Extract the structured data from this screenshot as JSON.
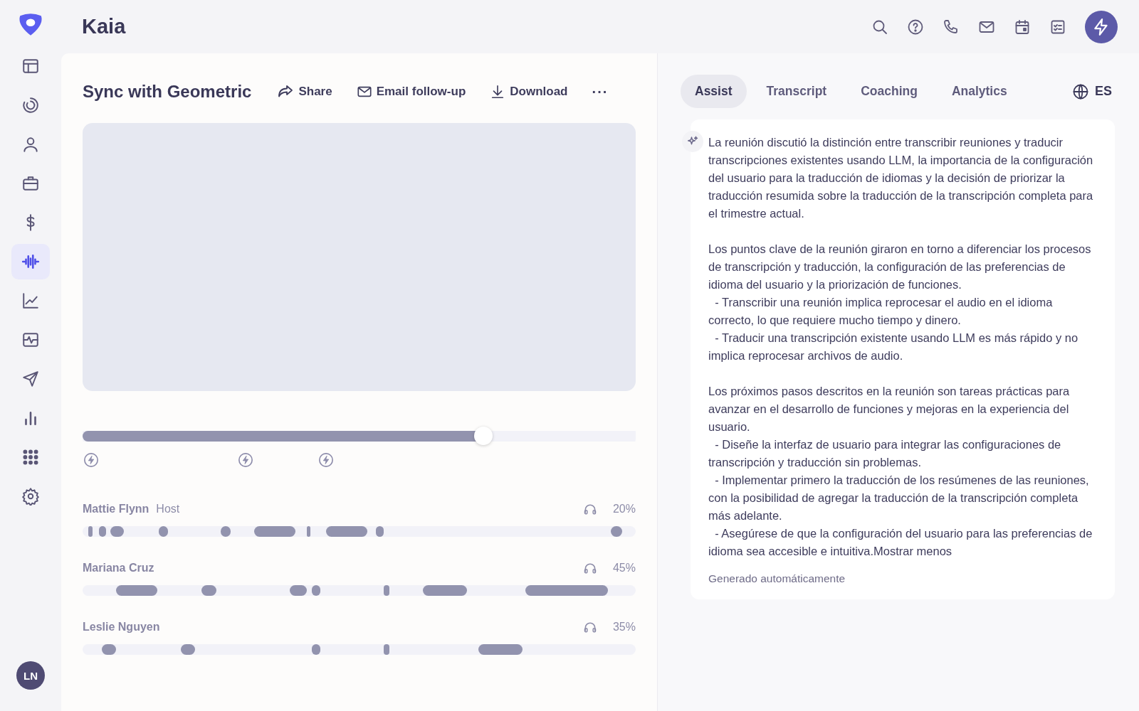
{
  "app": {
    "title": "Kaia",
    "user_initials": "LN"
  },
  "sidebar": {
    "items": [
      {
        "selected": false
      },
      {
        "selected": false
      },
      {
        "selected": false
      },
      {
        "selected": false
      },
      {
        "selected": false
      },
      {
        "selected": true
      },
      {
        "selected": false
      },
      {
        "selected": false
      },
      {
        "selected": false
      },
      {
        "selected": false
      },
      {
        "selected": false
      },
      {
        "selected": false
      }
    ]
  },
  "call": {
    "title": "Sync with Geometric",
    "actions": [
      {
        "kind": "share",
        "label": "Share"
      },
      {
        "kind": "email",
        "label": "Email follow-up"
      },
      {
        "kind": "download",
        "label": "Download"
      },
      {
        "kind": "more",
        "label": "···"
      }
    ],
    "playback": {
      "level": 0.725
    },
    "speakers": [
      {
        "name": "Mattie Flynn",
        "role": "Host",
        "share": "20%"
      },
      {
        "name": "Mariana Cruz",
        "share": "45%"
      },
      {
        "name": "Leslie Nguyen",
        "share": "35%"
      }
    ]
  },
  "panel": {
    "tabs": [
      {
        "label": "Assist",
        "selected": true
      },
      {
        "label": "Transcript",
        "selected": false
      },
      {
        "label": "Coaching",
        "selected": false
      },
      {
        "label": "Analytics",
        "selected": false
      }
    ],
    "language": "ES",
    "summary": [
      [
        "La reunión discutió la distinción entre transcribir reuniones y traducir transcripciones existentes usando LLM, la importancia de la configuración del usuario para la traducción de idiomas y la decisión de priorizar la traducción resumida sobre la traducción de la transcripción completa para el trimestre actual."
      ],
      [
        "Los puntos clave de la reunión giraron en torno a diferenciar los procesos de transcripción y traducción, la configuración de las preferencias de idioma del usuario y la priorización de funciones.",
        "  - Transcribir una reunión implica reprocesar el audio en el idioma correcto, lo que requiere mucho tiempo y dinero.",
        "  - Traducir una transcripción existente usando LLM es más rápido y no implica reprocesar archivos de audio."
      ],
      [
        "Los próximos pasos descritos en la reunión son tareas prácticas para avanzar en el desarrollo de funciones y mejoras en la experiencia del usuario.",
        "  - Diseñe la interfaz de usuario para integrar las configuraciones de transcripción y traducción sin problemas.",
        "  - Implementar primero la traducción de los resúmenes de las reuniones, con la posibilidad de agregar la traducción de la transcripción completa más adelante.",
        "  - Asegúrese de que la configuración del usuario para las preferencias de idioma sea accesible e intuitiva.Mostrar menos"
      ]
    ],
    "footnote": "Generado automáticamente"
  }
}
